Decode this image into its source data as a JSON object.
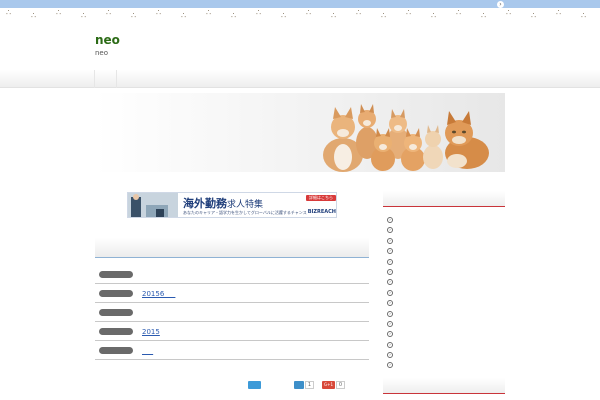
{
  "site": {
    "title": "neo",
    "description": "neo"
  },
  "header": {
    "image_label": "cats-header"
  },
  "ad": {
    "headline_bold": "海外勤務",
    "headline_rest": "求人特集",
    "subline": "あなたのキャリア・語学力を生かしてグローバルに活躍するチャンス",
    "button": "詳細はこちら",
    "brand": "BIZREACH"
  },
  "posts": [
    {
      "link": ""
    },
    {
      "link": "20156     "
    },
    {
      "link": ""
    },
    {
      "link": "2015"
    },
    {
      "link": "     "
    }
  ],
  "share": {
    "count_one": "1",
    "count_two": "0",
    "google_label": "G+1"
  },
  "sidebar": {
    "item_count": 15
  },
  "colors": {
    "top_band": "#a9c8ec",
    "title_green": "#2c6b16",
    "link_blue": "#2a5ab0",
    "widget_red": "#c9343a"
  }
}
